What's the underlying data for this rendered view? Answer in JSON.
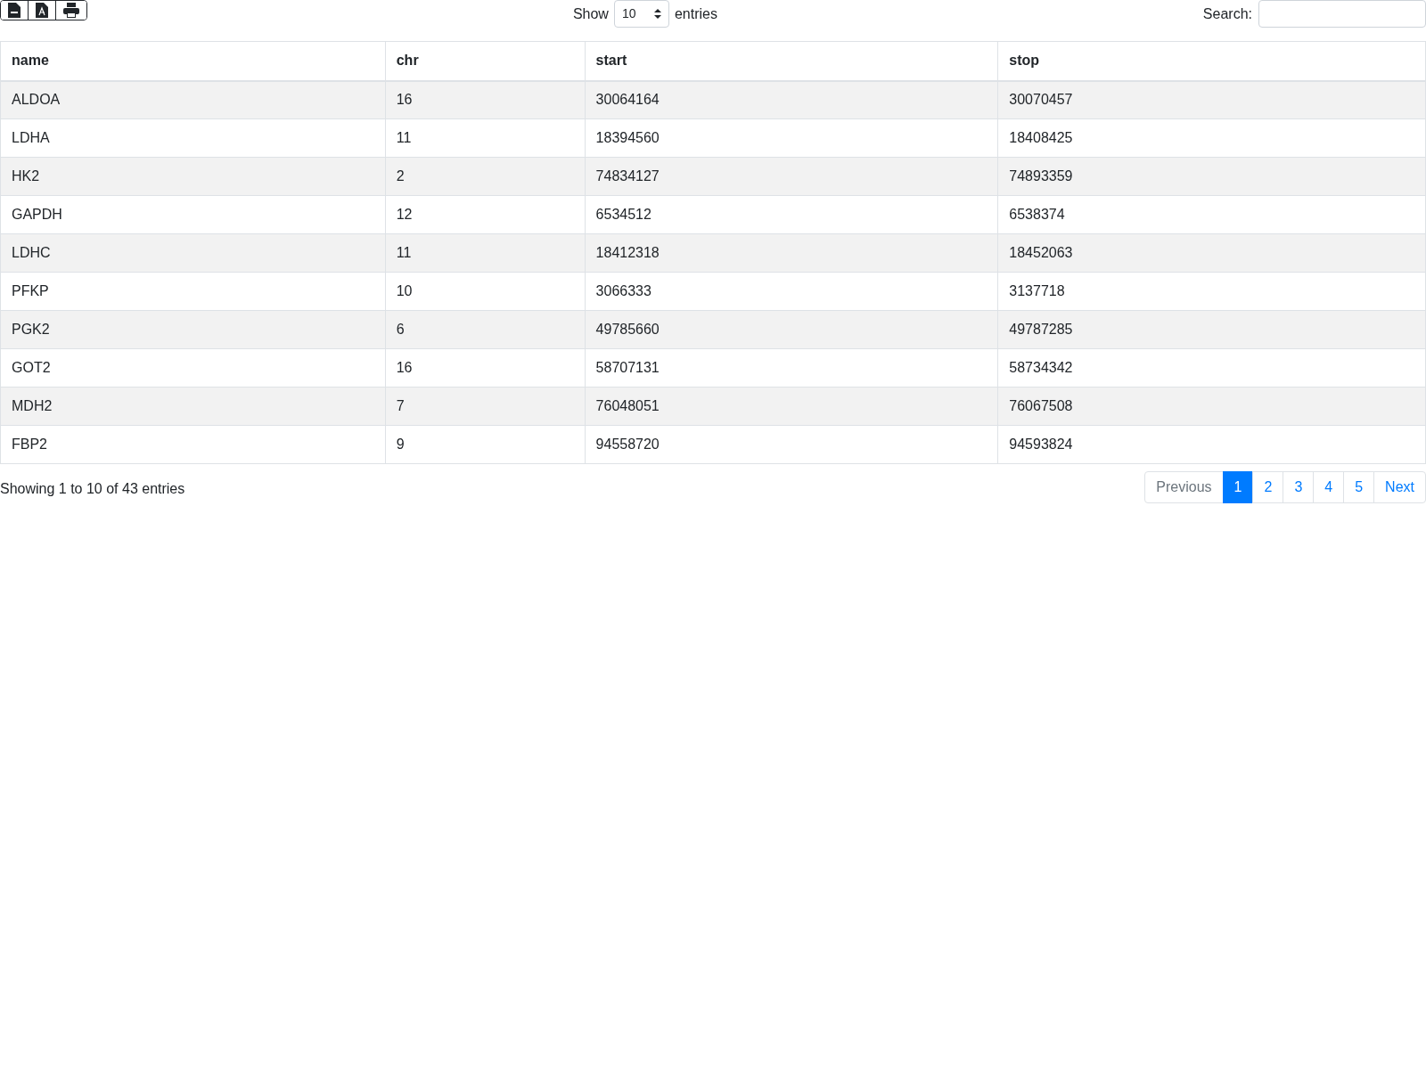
{
  "toolbar": {
    "buttons": [
      {
        "kind": "csv"
      },
      {
        "kind": "pdf"
      },
      {
        "kind": "print"
      }
    ]
  },
  "length": {
    "label_before": "Show",
    "value": "10",
    "label_after": "entries"
  },
  "search": {
    "label": "Search:"
  },
  "table": {
    "columns": [
      "name",
      "chr",
      "start",
      "stop"
    ],
    "rows": [
      [
        "ALDOA",
        "16",
        "30064164",
        "30070457"
      ],
      [
        "LDHA",
        "11",
        "18394560",
        "18408425"
      ],
      [
        "HK2",
        "2",
        "74834127",
        "74893359"
      ],
      [
        "GAPDH",
        "12",
        "6534512",
        "6538374"
      ],
      [
        "LDHC",
        "11",
        "18412318",
        "18452063"
      ],
      [
        "PFKP",
        "10",
        "3066333",
        "3137718"
      ],
      [
        "PGK2",
        "6",
        "49785660",
        "49787285"
      ],
      [
        "GOT2",
        "16",
        "58707131",
        "58734342"
      ],
      [
        "MDH2",
        "7",
        "76048051",
        "76067508"
      ],
      [
        "FBP2",
        "9",
        "94558720",
        "94593824"
      ]
    ]
  },
  "info": "Showing 1 to 10 of 43 entries",
  "pagination": [
    {
      "label": "Previous",
      "selected": false,
      "disabled": true
    },
    {
      "label": "1",
      "selected": true,
      "disabled": false
    },
    {
      "label": "2",
      "selected": false,
      "disabled": false
    },
    {
      "label": "3",
      "selected": false,
      "disabled": false
    },
    {
      "label": "4",
      "selected": false,
      "disabled": false
    },
    {
      "label": "5",
      "selected": false,
      "disabled": false
    },
    {
      "label": "Next",
      "selected": false,
      "disabled": false
    }
  ]
}
